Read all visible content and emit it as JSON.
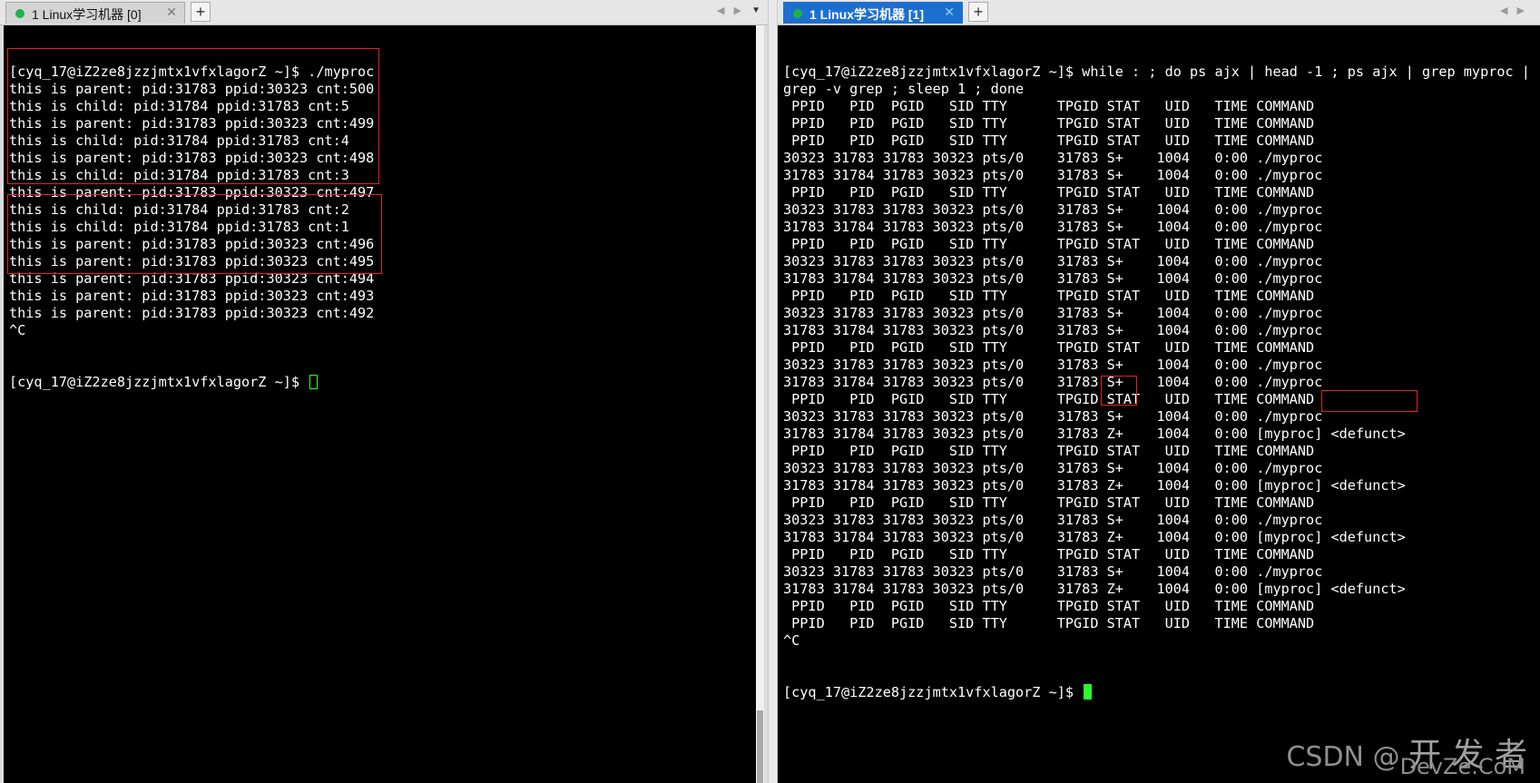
{
  "left_pane": {
    "tab_label": "1 Linux学习机器 [0]",
    "lines": [
      "[cyq_17@iZ2ze8jzzjmtx1vfxlagorZ ~]$ ./myproc",
      "this is parent: pid:31783 ppid:30323 cnt:500",
      "this is child: pid:31784 ppid:31783 cnt:5",
      "this is parent: pid:31783 ppid:30323 cnt:499",
      "this is child: pid:31784 ppid:31783 cnt:4",
      "this is parent: pid:31783 ppid:30323 cnt:498",
      "this is child: pid:31784 ppid:31783 cnt:3",
      "this is parent: pid:31783 ppid:30323 cnt:497",
      "this is child: pid:31784 ppid:31783 cnt:2",
      "this is child: pid:31784 ppid:31783 cnt:1",
      "this is parent: pid:31783 ppid:30323 cnt:496",
      "this is parent: pid:31783 ppid:30323 cnt:495",
      "this is parent: pid:31783 ppid:30323 cnt:494",
      "this is parent: pid:31783 ppid:30323 cnt:493",
      "this is parent: pid:31783 ppid:30323 cnt:492",
      "^C"
    ],
    "prompt": "[cyq_17@iZ2ze8jzzjmtx1vfxlagorZ ~]$ "
  },
  "right_pane": {
    "tab_label": "1 Linux学习机器 [1]",
    "lines": [
      "[cyq_17@iZ2ze8jzzjmtx1vfxlagorZ ~]$ while : ; do ps ajx | head -1 ; ps ajx | grep myproc |",
      "grep -v grep ; sleep 1 ; done",
      " PPID   PID  PGID   SID TTY      TPGID STAT   UID   TIME COMMAND",
      " PPID   PID  PGID   SID TTY      TPGID STAT   UID   TIME COMMAND",
      " PPID   PID  PGID   SID TTY      TPGID STAT   UID   TIME COMMAND",
      "30323 31783 31783 30323 pts/0    31783 S+    1004   0:00 ./myproc",
      "31783 31784 31783 30323 pts/0    31783 S+    1004   0:00 ./myproc",
      " PPID   PID  PGID   SID TTY      TPGID STAT   UID   TIME COMMAND",
      "30323 31783 31783 30323 pts/0    31783 S+    1004   0:00 ./myproc",
      "31783 31784 31783 30323 pts/0    31783 S+    1004   0:00 ./myproc",
      " PPID   PID  PGID   SID TTY      TPGID STAT   UID   TIME COMMAND",
      "30323 31783 31783 30323 pts/0    31783 S+    1004   0:00 ./myproc",
      "31783 31784 31783 30323 pts/0    31783 S+    1004   0:00 ./myproc",
      " PPID   PID  PGID   SID TTY      TPGID STAT   UID   TIME COMMAND",
      "30323 31783 31783 30323 pts/0    31783 S+    1004   0:00 ./myproc",
      "31783 31784 31783 30323 pts/0    31783 S+    1004   0:00 ./myproc",
      " PPID   PID  PGID   SID TTY      TPGID STAT   UID   TIME COMMAND",
      "30323 31783 31783 30323 pts/0    31783 S+    1004   0:00 ./myproc",
      "31783 31784 31783 30323 pts/0    31783 S+    1004   0:00 ./myproc",
      " PPID   PID  PGID   SID TTY      TPGID STAT   UID   TIME COMMAND",
      "30323 31783 31783 30323 pts/0    31783 S+    1004   0:00 ./myproc",
      "31783 31784 31783 30323 pts/0    31783 Z+    1004   0:00 [myproc] <defunct>",
      " PPID   PID  PGID   SID TTY      TPGID STAT   UID   TIME COMMAND",
      "30323 31783 31783 30323 pts/0    31783 S+    1004   0:00 ./myproc",
      "31783 31784 31783 30323 pts/0    31783 Z+    1004   0:00 [myproc] <defunct>",
      " PPID   PID  PGID   SID TTY      TPGID STAT   UID   TIME COMMAND",
      "30323 31783 31783 30323 pts/0    31783 S+    1004   0:00 ./myproc",
      "31783 31784 31783 30323 pts/0    31783 Z+    1004   0:00 [myproc] <defunct>",
      " PPID   PID  PGID   SID TTY      TPGID STAT   UID   TIME COMMAND",
      "30323 31783 31783 30323 pts/0    31783 S+    1004   0:00 ./myproc",
      "31783 31784 31783 30323 pts/0    31783 Z+    1004   0:00 [myproc] <defunct>",
      " PPID   PID  PGID   SID TTY      TPGID STAT   UID   TIME COMMAND",
      " PPID   PID  PGID   SID TTY      TPGID STAT   UID   TIME COMMAND",
      "^C"
    ],
    "prompt": "[cyq_17@iZ2ze8jzzjmtx1vfxlagorZ ~]$ "
  },
  "watermark": {
    "brand": "CSDN",
    "at": "@",
    "site_cn": "开 发 者",
    "site_en": "DevZe.CoM"
  },
  "colors": {
    "terminal_bg": "#000000",
    "terminal_fg": "#ffffff",
    "cursor": "#2dff2d",
    "highlight_box": "#e6202a",
    "active_tab": "#1c6fcf"
  },
  "icons": {
    "tab_status": "green-dot-icon",
    "tab_close": "close-icon",
    "new_tab": "plus-icon",
    "scroll": "left-right-arrow-icon",
    "menu": "chevron-down-icon"
  }
}
